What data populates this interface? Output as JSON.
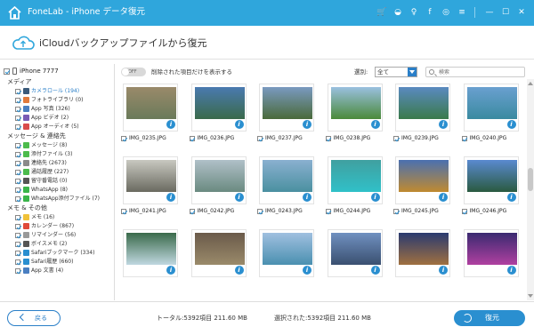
{
  "app": {
    "title": "FoneLab - iPhone データ復元"
  },
  "header": {
    "title": "iCloudバックアップファイルから復元"
  },
  "sidebar": {
    "device": "iPhone 7777",
    "categories": [
      {
        "label": "メディア",
        "items": [
          {
            "label": "カメラロール (194)",
            "selected": true,
            "color": "#3b5a7a"
          },
          {
            "label": "フォトライブラリ (0)",
            "selected": false,
            "color": "#e07a3c"
          },
          {
            "label": "App 写真 (326)",
            "selected": false,
            "color": "#4a7fc1"
          },
          {
            "label": "App ビデオ (2)",
            "selected": false,
            "color": "#7a5bb5"
          },
          {
            "label": "App オーディオ (5)",
            "selected": false,
            "color": "#d94b4b"
          }
        ]
      },
      {
        "label": "メッセージ & 連絡先",
        "items": [
          {
            "label": "メッセージ (8)",
            "selected": false,
            "color": "#4cbb4c"
          },
          {
            "label": "添付ファイル (3)",
            "selected": false,
            "color": "#4cbb4c"
          },
          {
            "label": "連絡先 (2673)",
            "selected": false,
            "color": "#8a8a8a"
          },
          {
            "label": "通話履歴 (227)",
            "selected": false,
            "color": "#4cbb4c"
          },
          {
            "label": "留守番電話 (0)",
            "selected": false,
            "color": "#555555"
          },
          {
            "label": "WhatsApp (8)",
            "selected": false,
            "color": "#3ab54a"
          },
          {
            "label": "WhatsApp添付ファイル (7)",
            "selected": false,
            "color": "#3ab54a"
          }
        ]
      },
      {
        "label": "メモ & その他",
        "items": [
          {
            "label": "メモ (16)",
            "selected": false,
            "color": "#f0c23a"
          },
          {
            "label": "カレンダー (867)",
            "selected": false,
            "color": "#e04a3a"
          },
          {
            "label": "リマインダー (56)",
            "selected": false,
            "color": "#999999"
          },
          {
            "label": "ボイスメモ (2)",
            "selected": false,
            "color": "#555555"
          },
          {
            "label": "Safariブックマーク (334)",
            "selected": false,
            "color": "#2a8fd0"
          },
          {
            "label": "Safari履歴 (660)",
            "selected": false,
            "color": "#2a8fd0"
          },
          {
            "label": "App 文書 (4)",
            "selected": false,
            "color": "#4a7fc1"
          }
        ]
      }
    ]
  },
  "toolbar": {
    "toggle_label": "OFF",
    "toggle_text": "削除された項目だけを表示する",
    "filter_label": "選別:",
    "filter_value": "全て",
    "search_placeholder": "検索"
  },
  "photos": [
    {
      "name": "IMG_0235.JPG",
      "c1": "#9a8a6a",
      "c2": "#6a7a5a"
    },
    {
      "name": "IMG_0236.JPG",
      "c1": "#4a7ab0",
      "c2": "#3a6a4a"
    },
    {
      "name": "IMG_0237.JPG",
      "c1": "#7a9ac0",
      "c2": "#4a6a3a"
    },
    {
      "name": "IMG_0238.JPG",
      "c1": "#9ac0e0",
      "c2": "#4a8a3a"
    },
    {
      "name": "IMG_0239.JPG",
      "c1": "#5a8ac0",
      "c2": "#3a7a4a"
    },
    {
      "name": "IMG_0240.JPG",
      "c1": "#6aa0d0",
      "c2": "#3a8aa0"
    },
    {
      "name": "IMG_0241.JPG",
      "c1": "#c8c8c0",
      "c2": "#6a6a60"
    },
    {
      "name": "IMG_0242.JPG",
      "c1": "#b0c0c8",
      "c2": "#6a8a80"
    },
    {
      "name": "IMG_0243.JPG",
      "c1": "#8ab0d0",
      "c2": "#4a90a0"
    },
    {
      "name": "IMG_0244.JPG",
      "c1": "#40a0a0",
      "c2": "#30c0c8"
    },
    {
      "name": "IMG_0245.JPG",
      "c1": "#4a70b0",
      "c2": "#c08a30"
    },
    {
      "name": "IMG_0246.JPG",
      "c1": "#5a8ad0",
      "c2": "#2a5a40"
    },
    {
      "name": "",
      "c1": "#3a6a4a",
      "c2": "#c0d8e0"
    },
    {
      "name": "",
      "c1": "#6a5a4a",
      "c2": "#9a8a6a"
    },
    {
      "name": "",
      "c1": "#a0c0e0",
      "c2": "#4a90b0"
    },
    {
      "name": "",
      "c1": "#7090c0",
      "c2": "#3a5070"
    },
    {
      "name": "",
      "c1": "#2a3a70",
      "c2": "#a07040"
    },
    {
      "name": "",
      "c1": "#3a2a70",
      "c2": "#b040a0"
    }
  ],
  "footer": {
    "back_label": "戻る",
    "total": "トータル:5392項目 211.60 MB",
    "selected": "選択された:5392項目 211.60 MB",
    "restore_label": "復元"
  },
  "colors": {
    "accent": "#2fa6dc",
    "button": "#2a8fd0"
  }
}
